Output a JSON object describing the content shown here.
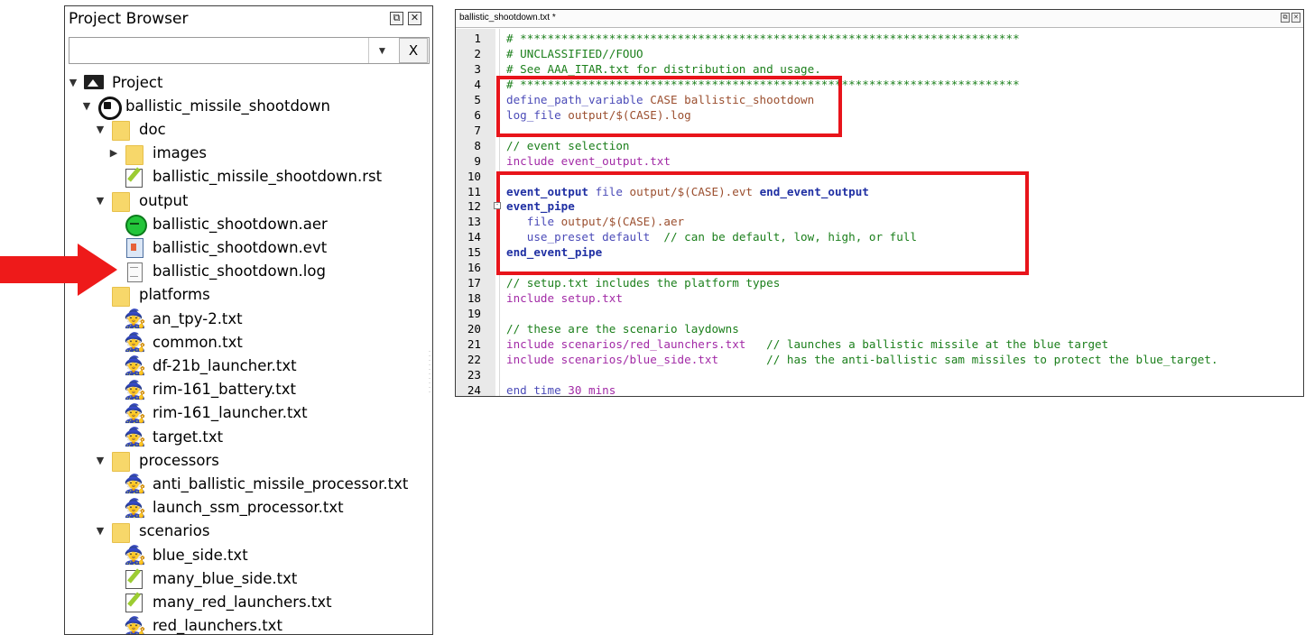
{
  "project_browser": {
    "title": "Project Browser",
    "float_button": "⧉",
    "close_button": "✕",
    "filter_value": "",
    "filter_combo": "▼",
    "filter_clear": "X",
    "tree": [
      {
        "label": "Project",
        "icon": "project-icon",
        "level": 0,
        "twisty": "▼"
      },
      {
        "label": "ballistic_missile_shootdown",
        "icon": "case-icon",
        "level": 1,
        "twisty": "▼"
      },
      {
        "label": "doc",
        "icon": "folder-icon",
        "level": 2,
        "twisty": "▼"
      },
      {
        "label": "images",
        "icon": "folder-icon",
        "level": 3,
        "twisty": "▶"
      },
      {
        "label": "ballistic_missile_shootdown.rst",
        "icon": "edit-icon",
        "level": 3,
        "twisty": ""
      },
      {
        "label": "output",
        "icon": "folder-icon",
        "level": 2,
        "twisty": "▼"
      },
      {
        "label": "ballistic_shootdown.aer",
        "icon": "aer-icon",
        "level": 3,
        "twisty": ""
      },
      {
        "label": "ballistic_shootdown.evt",
        "icon": "evt-icon",
        "level": 3,
        "twisty": ""
      },
      {
        "label": "ballistic_shootdown.log",
        "icon": "doc-icon",
        "level": 3,
        "twisty": ""
      },
      {
        "label": "platforms",
        "icon": "folder-icon",
        "level": 2,
        "twisty": ""
      },
      {
        "label": "an_tpy-2.txt",
        "icon": "wizard-icon",
        "level": 3,
        "twisty": ""
      },
      {
        "label": "common.txt",
        "icon": "wizard-icon",
        "level": 3,
        "twisty": ""
      },
      {
        "label": "df-21b_launcher.txt",
        "icon": "wizard-icon",
        "level": 3,
        "twisty": ""
      },
      {
        "label": "rim-161_battery.txt",
        "icon": "wizard-icon",
        "level": 3,
        "twisty": ""
      },
      {
        "label": "rim-161_launcher.txt",
        "icon": "wizard-icon",
        "level": 3,
        "twisty": ""
      },
      {
        "label": "target.txt",
        "icon": "wizard-icon",
        "level": 3,
        "twisty": ""
      },
      {
        "label": "processors",
        "icon": "folder-icon",
        "level": 2,
        "twisty": "▼"
      },
      {
        "label": "anti_ballistic_missile_processor.txt",
        "icon": "wizard-icon",
        "level": 3,
        "twisty": ""
      },
      {
        "label": "launch_ssm_processor.txt",
        "icon": "wizard-icon",
        "level": 3,
        "twisty": ""
      },
      {
        "label": "scenarios",
        "icon": "folder-icon",
        "level": 2,
        "twisty": "▼"
      },
      {
        "label": "blue_side.txt",
        "icon": "wizard-icon",
        "level": 3,
        "twisty": ""
      },
      {
        "label": "many_blue_side.txt",
        "icon": "edit-icon",
        "level": 3,
        "twisty": ""
      },
      {
        "label": "many_red_launchers.txt",
        "icon": "edit-icon",
        "level": 3,
        "twisty": ""
      },
      {
        "label": "red_launchers.txt",
        "icon": "wizard-icon",
        "level": 3,
        "twisty": ""
      }
    ]
  },
  "editor": {
    "tab_title": "ballistic_shootdown.txt *",
    "float_button": "⧉",
    "close_button": "✕",
    "lines": [
      {
        "n": "1",
        "tokens": [
          {
            "t": "# *************************************************************************",
            "c": "comment"
          }
        ]
      },
      {
        "n": "2",
        "tokens": [
          {
            "t": "# UNCLASSIFIED//FOUO",
            "c": "comment"
          }
        ]
      },
      {
        "n": "3",
        "tokens": [
          {
            "t": "# See AAA_ITAR.txt for distribution and usage.",
            "c": "comment"
          }
        ]
      },
      {
        "n": "4",
        "tokens": [
          {
            "t": "# *************************************************************************",
            "c": "comment"
          }
        ]
      },
      {
        "n": "5",
        "tokens": [
          {
            "t": "define_path_variable",
            "c": "cmd"
          },
          {
            "t": " CASE ballistic_shootdown",
            "c": "val"
          }
        ]
      },
      {
        "n": "6",
        "tokens": [
          {
            "t": "log_file",
            "c": "cmd"
          },
          {
            "t": " output/$(CASE).log",
            "c": "val"
          }
        ]
      },
      {
        "n": "7",
        "tokens": []
      },
      {
        "n": "8",
        "tokens": [
          {
            "t": "// event selection",
            "c": "comment"
          }
        ]
      },
      {
        "n": "9",
        "tokens": [
          {
            "t": "include event_output.txt",
            "c": "inc"
          }
        ]
      },
      {
        "n": "10",
        "tokens": []
      },
      {
        "n": "11",
        "tokens": [
          {
            "t": "event_output",
            "c": "kw"
          },
          {
            "t": " file",
            "c": "cmd"
          },
          {
            "t": " output/$(CASE).evt ",
            "c": "val"
          },
          {
            "t": "end_event_output",
            "c": "kw"
          }
        ]
      },
      {
        "n": "12",
        "tokens": [
          {
            "t": "event_pipe",
            "c": "kw"
          }
        ],
        "fold": true
      },
      {
        "n": "13",
        "tokens": [
          {
            "t": "   file",
            "c": "cmd"
          },
          {
            "t": " output/$(CASE).aer",
            "c": "val"
          }
        ]
      },
      {
        "n": "14",
        "tokens": [
          {
            "t": "   use_preset",
            "c": "cmd"
          },
          {
            "t": " default",
            "c": "cmd"
          },
          {
            "t": "  // can be default, low, high, or full",
            "c": "comment"
          }
        ]
      },
      {
        "n": "15",
        "tokens": [
          {
            "t": "end_event_pipe",
            "c": "kw"
          }
        ]
      },
      {
        "n": "16",
        "tokens": []
      },
      {
        "n": "17",
        "tokens": [
          {
            "t": "// setup.txt includes the platform types",
            "c": "comment"
          }
        ]
      },
      {
        "n": "18",
        "tokens": [
          {
            "t": "include setup.txt",
            "c": "inc"
          }
        ]
      },
      {
        "n": "19",
        "tokens": []
      },
      {
        "n": "20",
        "tokens": [
          {
            "t": "// these are the scenario laydowns",
            "c": "comment"
          }
        ]
      },
      {
        "n": "21",
        "tokens": [
          {
            "t": "include scenarios/red_launchers.txt",
            "c": "inc"
          },
          {
            "t": "   // launches a ballistic missile at the blue target",
            "c": "comment"
          }
        ]
      },
      {
        "n": "22",
        "tokens": [
          {
            "t": "include scenarios/blue_side.txt",
            "c": "inc"
          },
          {
            "t": "       // has the anti-ballistic sam missiles to protect the blue_target.",
            "c": "comment"
          }
        ]
      },
      {
        "n": "23",
        "tokens": []
      },
      {
        "n": "24",
        "tokens": [
          {
            "t": "end_time",
            "c": "cmd"
          },
          {
            "t": " 30 mins",
            "c": "num"
          }
        ]
      }
    ]
  },
  "colors": {
    "highlight": "#e8141b",
    "arrow": "#ee1a1a",
    "comment": "#1b7f1b",
    "keyword": "#1f2fa3"
  }
}
